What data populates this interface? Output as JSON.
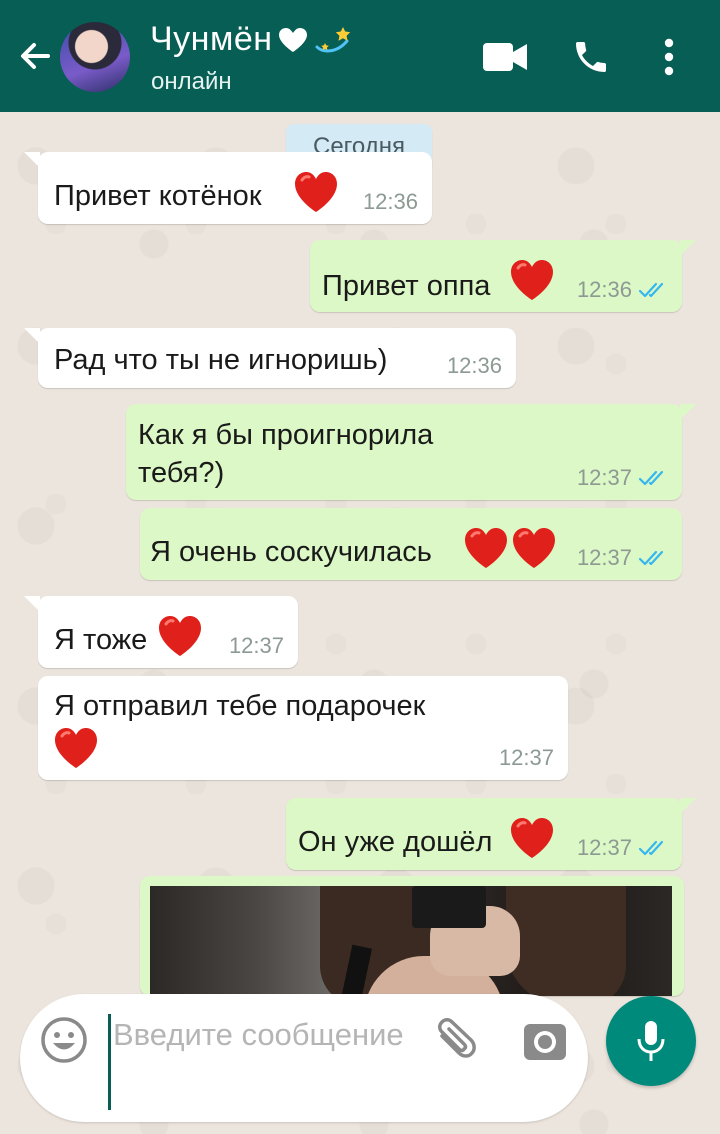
{
  "header": {
    "contact_name": "Чунмён",
    "status": "онлайн",
    "colors": {
      "bar": "#075e54",
      "text": "#ffffff"
    },
    "icons": [
      "back-arrow-icon",
      "video-call-icon",
      "phone-icon",
      "more-vert-icon"
    ]
  },
  "chat": {
    "date_chip": "Сегодня",
    "messages": [
      {
        "direction": "in",
        "text": "Привет котёнок",
        "time": "12:36",
        "emoji": "heart"
      },
      {
        "direction": "out",
        "text": "Привет оппа",
        "time": "12:36",
        "emoji": "heart",
        "read": true
      },
      {
        "direction": "in",
        "text": "Рад что ты не игноришь)",
        "time": "12:36"
      },
      {
        "direction": "out",
        "text_line1": "Как я бы проигнорила",
        "text_line2": "тебя?)",
        "time": "12:37",
        "read": true
      },
      {
        "direction": "out",
        "text": "Я очень соскучилась",
        "time": "12:37",
        "emoji": "heart-heart",
        "read": true
      },
      {
        "direction": "in",
        "text": "Я тоже",
        "time": "12:37",
        "emoji": "heart"
      },
      {
        "direction": "in",
        "text": "Я отправил тебе подарочек",
        "time": "12:37",
        "emoji": "heart"
      },
      {
        "direction": "out",
        "text": "Он уже дошёл",
        "time": "12:37",
        "emoji": "heart",
        "read": true
      }
    ],
    "colors": {
      "incoming": "#ffffff",
      "outgoing": "#dcf8c6",
      "read_ticks": "#34b7f1",
      "heart": "#e0201a"
    }
  },
  "composer": {
    "placeholder": "Введите сообщение",
    "icons": [
      "emoji-icon",
      "attach-icon",
      "camera-icon",
      "mic-icon"
    ],
    "accent": "#008a7c"
  }
}
